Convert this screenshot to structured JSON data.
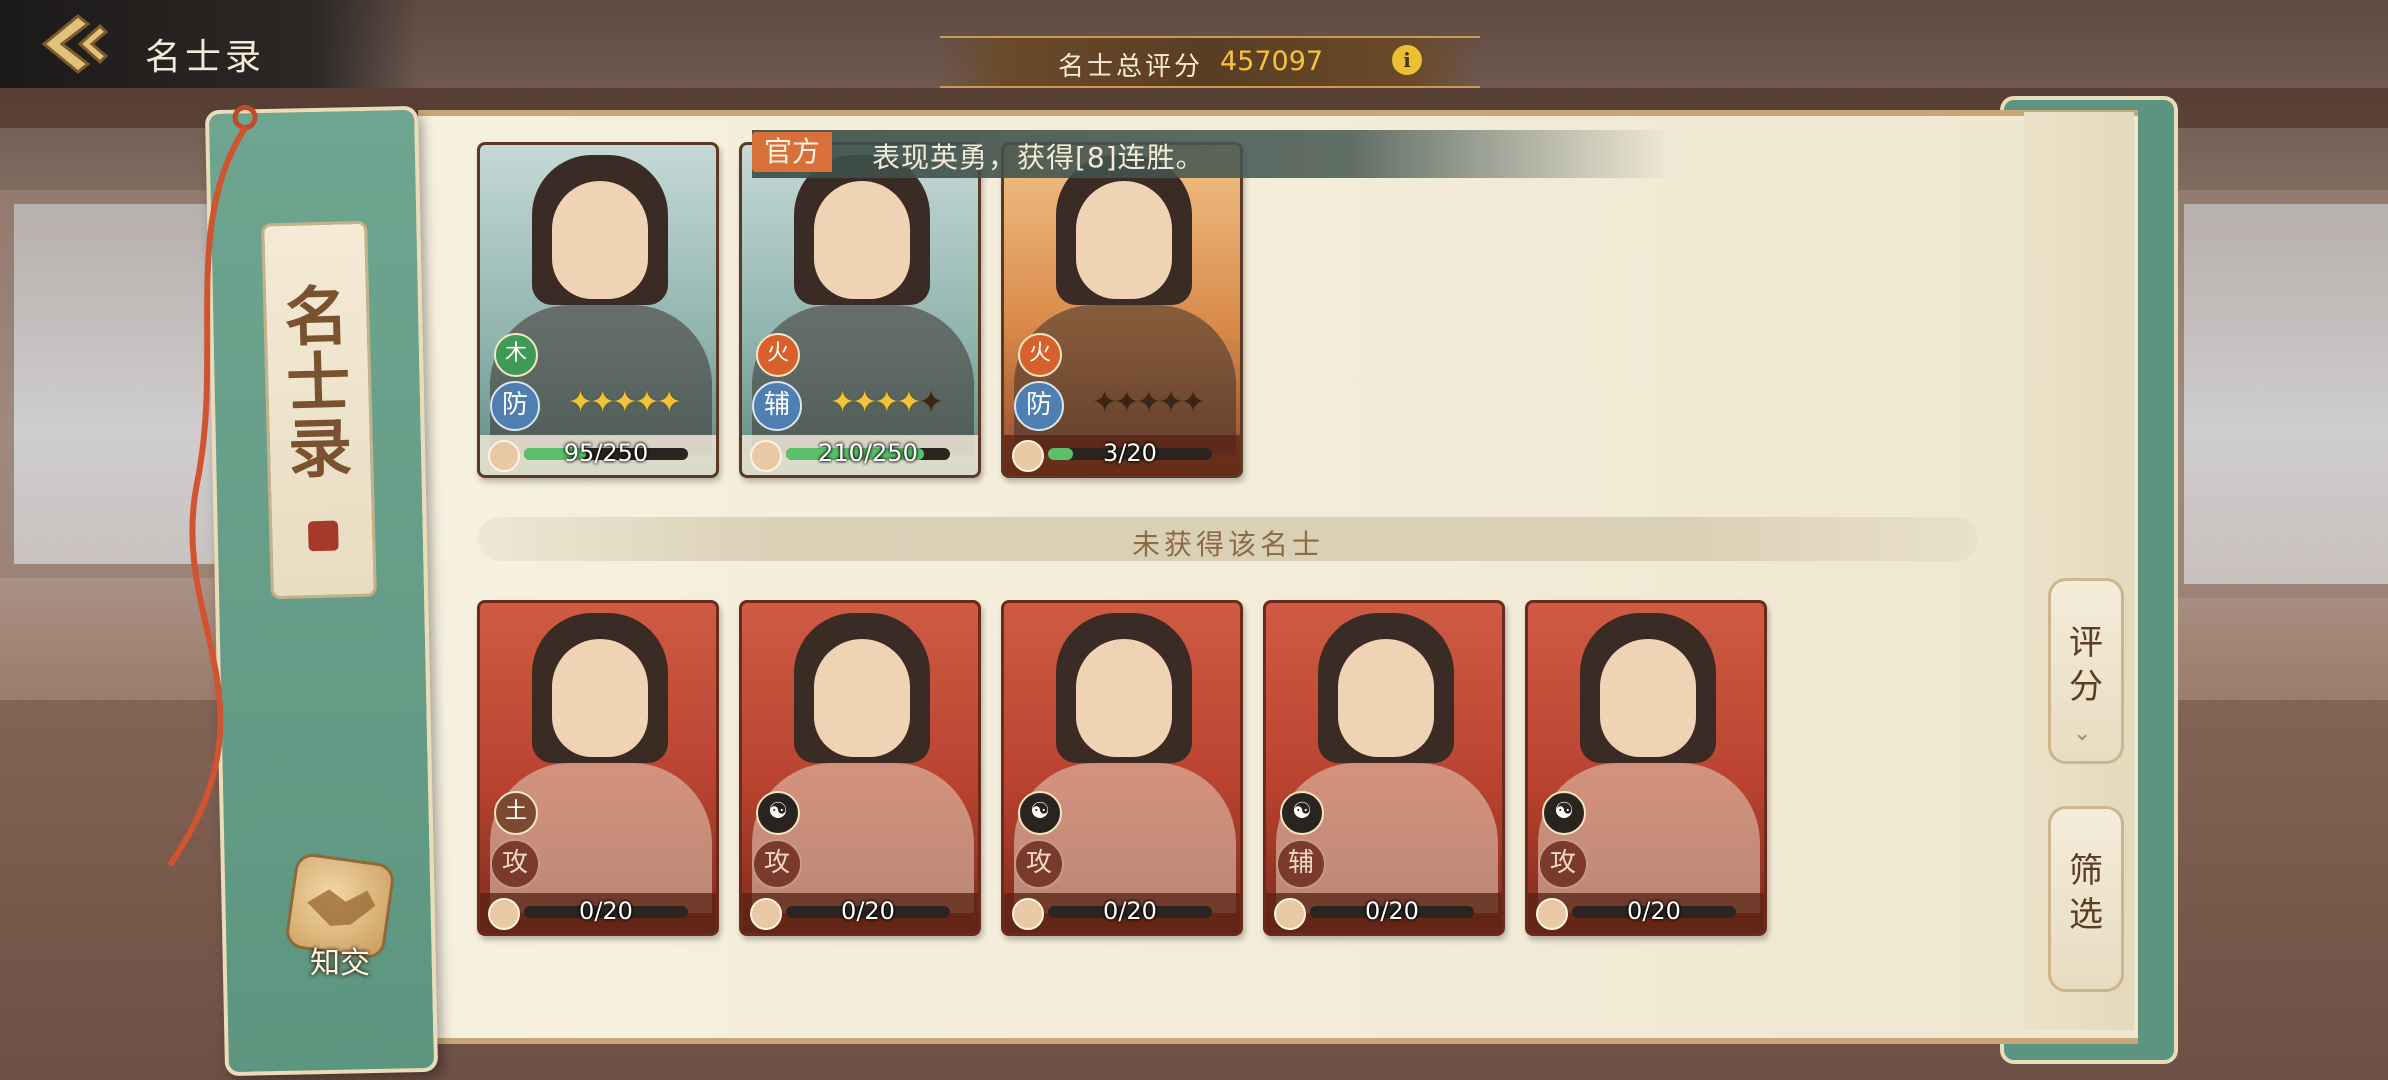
{
  "header": {
    "title": "名士录",
    "back_icon": "back-arrow-icon"
  },
  "score": {
    "label": "名士总评分",
    "value": "457097",
    "info_icon": "i"
  },
  "notice": {
    "tag": "官方",
    "text": "表现英勇，获得[8]连胜。"
  },
  "bookmark": {
    "title": "名士录",
    "friend_label": "知交"
  },
  "owned_cards": [
    {
      "element": "木",
      "role": "防",
      "stars_lit": 5,
      "stars_total": 5,
      "progress": "95/250",
      "fill": 0.38,
      "theme": "owned-teal"
    },
    {
      "element": "火",
      "role": "辅",
      "stars_lit": 4,
      "stars_total": 5,
      "progress": "210/250",
      "fill": 0.84,
      "theme": "owned-teal"
    },
    {
      "element": "火",
      "role": "防",
      "stars_lit": 0,
      "stars_total": 5,
      "progress": "3/20",
      "fill": 0.15,
      "theme": "owned-gold"
    }
  ],
  "section": {
    "label": "未获得该名士"
  },
  "locked_cards": [
    {
      "element": "土",
      "role": "攻",
      "progress": "0/20",
      "fill": 0
    },
    {
      "element": "☯",
      "role": "攻",
      "progress": "0/20",
      "fill": 0
    },
    {
      "element": "☯",
      "role": "攻",
      "progress": "0/20",
      "fill": 0
    },
    {
      "element": "☯",
      "role": "辅",
      "progress": "0/20",
      "fill": 0
    },
    {
      "element": "☯",
      "role": "攻",
      "progress": "0/20",
      "fill": 0
    }
  ],
  "side_buttons": {
    "score_sort": "评分",
    "filter": "筛选"
  },
  "colors": {
    "wood": "#3f9a55",
    "fire": "#d8612b",
    "earth": "#7d4a30",
    "yinyang": "#2a2420",
    "defense": "#4f7fb0",
    "support": "#5f8f88"
  }
}
